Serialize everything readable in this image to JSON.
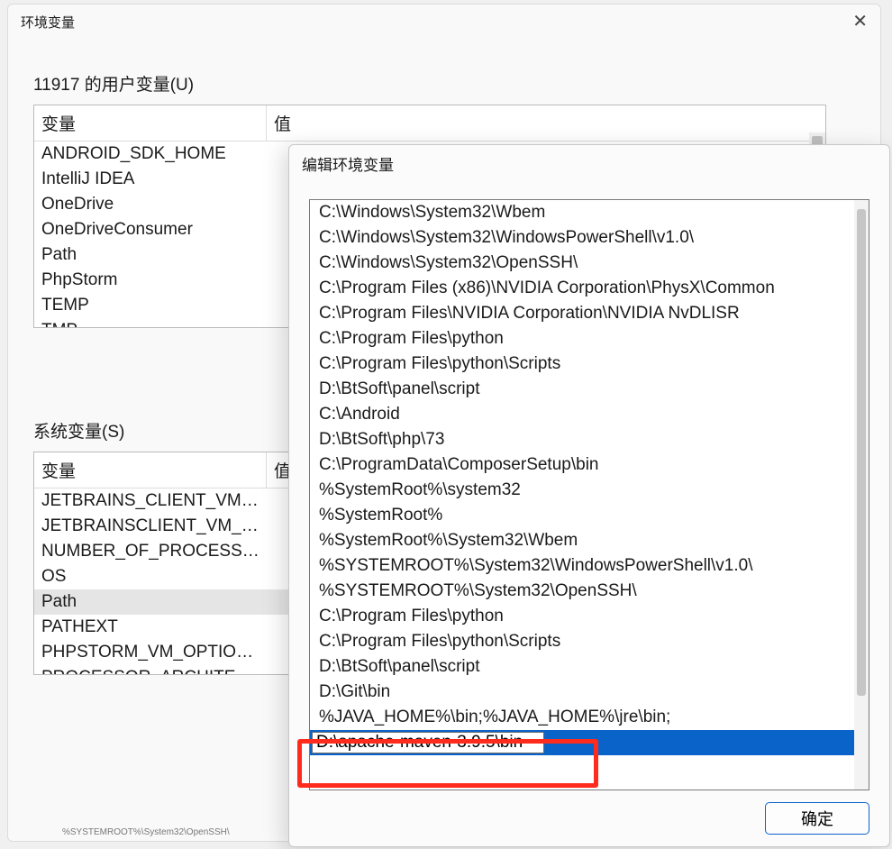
{
  "env_dialog": {
    "title": "环境变量",
    "user_group_label": "11917 的用户变量(U)",
    "system_group_label": "系统变量(S)",
    "col_var": "变量",
    "col_val": "值",
    "user_vars": [
      {
        "name": "ANDROID_SDK_HOME",
        "value": ""
      },
      {
        "name": "IntelliJ IDEA",
        "value": ""
      },
      {
        "name": "OneDrive",
        "value": ""
      },
      {
        "name": "OneDriveConsumer",
        "value": ""
      },
      {
        "name": "Path",
        "value": ""
      },
      {
        "name": "PhpStorm",
        "value": ""
      },
      {
        "name": "TEMP",
        "value": ""
      },
      {
        "name": "TMP",
        "value": ""
      }
    ],
    "system_vars": [
      {
        "name": "JETBRAINS_CLIENT_VM_OPT...",
        "value": ""
      },
      {
        "name": "JETBRAINSCLIENT_VM_OPTI...",
        "value": ""
      },
      {
        "name": "NUMBER_OF_PROCESSORS",
        "value": ""
      },
      {
        "name": "OS",
        "value": ""
      },
      {
        "name": "Path",
        "value": "",
        "selected": true
      },
      {
        "name": "PATHEXT",
        "value": ""
      },
      {
        "name": "PHPSTORM_VM_OPTIONS",
        "value": ""
      },
      {
        "name": "PROCESSOR_ARCHITECTURE",
        "value": ""
      }
    ],
    "stray_text": "%SYSTEMROOT%\\System32\\OpenSSH\\"
  },
  "edit_dialog": {
    "title": "编辑环境变量",
    "ok_label": "确定",
    "edit_value": "D:\\apache-maven-3.9.5\\bin",
    "paths": [
      "C:\\Windows\\System32\\Wbem",
      "C:\\Windows\\System32\\WindowsPowerShell\\v1.0\\",
      "C:\\Windows\\System32\\OpenSSH\\",
      "C:\\Program Files (x86)\\NVIDIA Corporation\\PhysX\\Common",
      "C:\\Program Files\\NVIDIA Corporation\\NVIDIA NvDLISR",
      "C:\\Program Files\\python",
      "C:\\Program Files\\python\\Scripts",
      "D:\\BtSoft\\panel\\script",
      "C:\\Android",
      "D:\\BtSoft\\php\\73",
      "C:\\ProgramData\\ComposerSetup\\bin",
      "%SystemRoot%\\system32",
      "%SystemRoot%",
      "%SystemRoot%\\System32\\Wbem",
      "%SYSTEMROOT%\\System32\\WindowsPowerShell\\v1.0\\",
      "%SYSTEMROOT%\\System32\\OpenSSH\\",
      "C:\\Program Files\\python",
      "C:\\Program Files\\python\\Scripts",
      "D:\\BtSoft\\panel\\script",
      "D:\\Git\\bin",
      "%JAVA_HOME%\\bin;%JAVA_HOME%\\jre\\bin;",
      "D:\\apache-maven-3.9.5\\bin"
    ],
    "selected_index": 21
  }
}
